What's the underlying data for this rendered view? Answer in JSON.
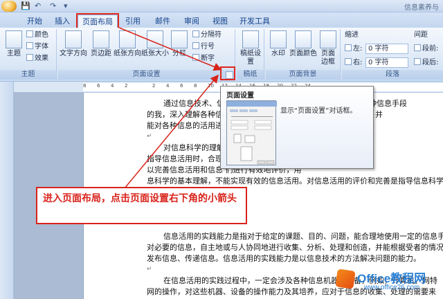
{
  "window": {
    "title": "信息素养与"
  },
  "quick_access": {
    "save_glyph": "💾",
    "undo_glyph": "↶",
    "redo_glyph": "↷",
    "menu_glyph": "▾"
  },
  "tabs": [
    {
      "label": "开始"
    },
    {
      "label": "插入"
    },
    {
      "label": "页面布局",
      "active": true
    },
    {
      "label": "引用"
    },
    {
      "label": "邮件"
    },
    {
      "label": "审阅"
    },
    {
      "label": "视图"
    },
    {
      "label": "开发工具"
    }
  ],
  "ribbon": {
    "theme_group": {
      "label": "主题",
      "main_button": "主题",
      "colors": "颜色",
      "fonts": "字体",
      "effects": "效果"
    },
    "page_setup_group": {
      "label": "页面设置",
      "text_direction": "文字方向",
      "margins": "页边距",
      "orientation": "纸张方向",
      "size": "纸张大小",
      "columns": "分栏",
      "breaks": "分隔符",
      "line_numbers": "行号",
      "hyphenation": "断字"
    },
    "manuscript_group": {
      "label": "稿纸",
      "manuscript_button": "稿纸设置"
    },
    "page_bg_group": {
      "label": "页面背景",
      "watermark": "水印",
      "page_color": "页面颜色",
      "page_borders": "页面边框"
    },
    "paragraph_group": {
      "label": "段落",
      "indent_label": "缩进",
      "spacing_label": "间距",
      "left_label": "左:",
      "right_label": "右:",
      "left_value": "0 字符",
      "right_value": "0 字符",
      "before_label": "段前:",
      "after_label": "段后:"
    }
  },
  "ruler": {
    "ticks": [
      "8",
      "6",
      "4",
      "2",
      "2",
      "4",
      "6",
      "8",
      "10",
      "12",
      "14",
      "16",
      "18",
      "20",
      "22",
      "24"
    ]
  },
  "tooltip": {
    "title": "页面设置",
    "description": "显示“页面设置”对话框。"
  },
  "document": {
    "paragraphs": [
      "通过信息技术、信息科学的理解。加深对信息技术人地理解各种信息手段",
      "的我，深入理解各种信息手段的作用，能够对信息进行适当的处理，并",
      "能对各种信息的活用进",
      "",
      "对信息科学的理解，",
      "指导信息活用时，合理                                      通过信息科学的理解，",
      "以完善信息活用和信息                                      们进行有效地评价，用",
      "息科学的基本理解，不能实现有效的信息活用。对信息活用的评价和完善是指导信息科学",
      "基础学习的重要理解。",
      "",
      "信息活用的实践能力是指对于给定的课题、目的、问题，能合理地使用一定的信息手段，",
      "对必要的信息，自主地或与人协同地进行收集、分析、处理和创造，并能根据受者的情况，",
      "发布信息、传递信息。信息活用的实践能力是以信息技术的方法解决问题的能力。",
      "",
      "在信息活用的实践过程中，一定会涉及各种信息机器、设备，例如，计算机、网特",
      "网的操作，对这些机器、设备的操作能力及其培养，应对于信息的收集、处理的需要来"
    ]
  },
  "callout": {
    "text": "进入页面布局，点击页面设置右下角的小箭头"
  },
  "watermark": {
    "brand": "Office教程网",
    "url": "www.office26.com"
  },
  "colors": {
    "annotation_red": "#d8231b",
    "ribbon_blue": "#15428b"
  }
}
